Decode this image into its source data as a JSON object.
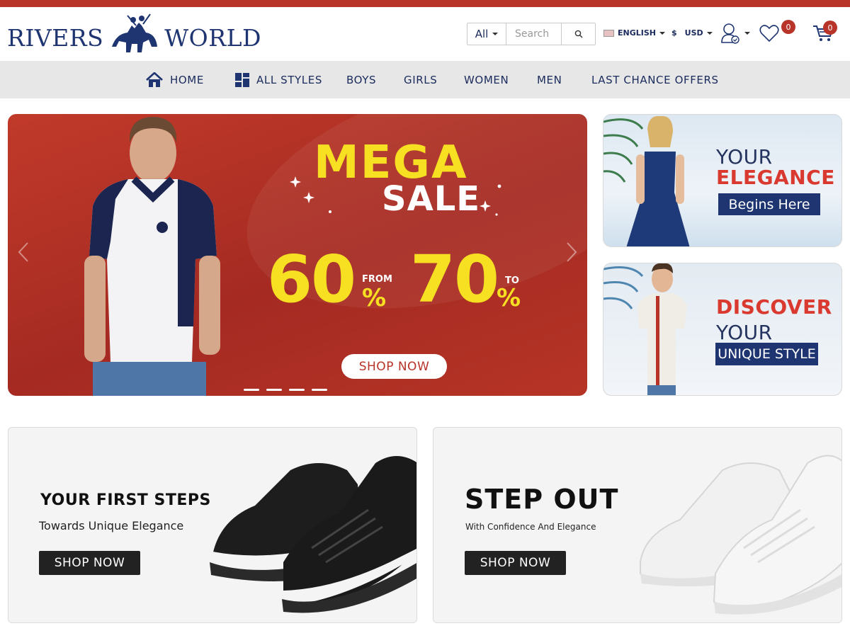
{
  "brand": {
    "name_left": "RIVERS",
    "name_right": "WORLD",
    "primary_color": "#1f3572",
    "accent_color": "#b83328"
  },
  "header": {
    "search": {
      "category": "All",
      "placeholder": "Search"
    },
    "language": "ENGLISH",
    "currency_symbol": "$",
    "currency": "USD",
    "wishlist_count": "0",
    "cart_count": "0"
  },
  "nav": {
    "items": [
      {
        "label": "HOME",
        "icon": "home-icon"
      },
      {
        "label": "ALL STYLES",
        "icon": "grid-icon"
      },
      {
        "label": "BOYS"
      },
      {
        "label": "GIRLS"
      },
      {
        "label": "WOMEN"
      },
      {
        "label": "MEN"
      },
      {
        "label": "LAST CHANCE OFFERS"
      }
    ]
  },
  "hero": {
    "line1": "MEGA",
    "line2": "SALE",
    "num_from": "60",
    "pct": "%",
    "from_label": "FROM",
    "num_to": "70",
    "to_label": "TO",
    "button": "SHOP NOW",
    "slides": 4
  },
  "side_banners": [
    {
      "line1": "YOUR",
      "line2": "ELEGANCE",
      "tag": "Begins Here"
    },
    {
      "line1": "DISCOVER",
      "line2": "YOUR",
      "tag": "UNIQUE STYLE"
    }
  ],
  "promos": [
    {
      "title": "YOUR FIRST STEPS",
      "subtitle": "Towards Unique Elegance",
      "button": "SHOP NOW"
    },
    {
      "title": "STEP OUT",
      "subtitle": "With Confidence And Elegance",
      "button": "SHOP NOW"
    }
  ]
}
